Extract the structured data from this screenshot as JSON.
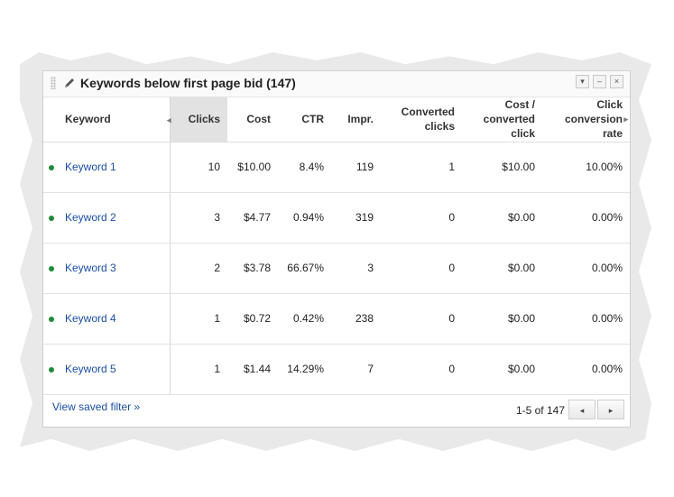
{
  "widget": {
    "title": "Keywords below first page bid (147)",
    "icons": {
      "drag": "grip-icon",
      "edit": "pencil-icon",
      "menu": "dropdown-icon",
      "minimize": "minimize-icon",
      "close": "close-icon"
    },
    "menu_glyph": "▾",
    "minimize_glyph": "–",
    "close_glyph": "×"
  },
  "table": {
    "columns": {
      "keyword": "Keyword",
      "clicks": "Clicks",
      "cost": "Cost",
      "ctr": "CTR",
      "impr": "Impr.",
      "converted_clicks": "Converted clicks",
      "cost_per_converted_click": "Cost / converted click",
      "click_conversion_rate": "Click conversion rate"
    },
    "sorted_column": "clicks",
    "scroll_left_glyph": "◂",
    "scroll_right_glyph": "▸",
    "rows": [
      {
        "keyword": "Keyword 1",
        "clicks": "10",
        "cost": "$10.00",
        "ctr": "8.4%",
        "impr": "119",
        "converted": "1",
        "cpc": "$10.00",
        "rate": "10.00%"
      },
      {
        "keyword": "Keyword 2",
        "clicks": "3",
        "cost": "$4.77",
        "ctr": "0.94%",
        "impr": "319",
        "converted": "0",
        "cpc": "$0.00",
        "rate": "0.00%"
      },
      {
        "keyword": "Keyword 3",
        "clicks": "2",
        "cost": "$3.78",
        "ctr": "66.67%",
        "impr": "3",
        "converted": "0",
        "cpc": "$0.00",
        "rate": "0.00%"
      },
      {
        "keyword": "Keyword 4",
        "clicks": "1",
        "cost": "$0.72",
        "ctr": "0.42%",
        "impr": "238",
        "converted": "0",
        "cpc": "$0.00",
        "rate": "0.00%"
      },
      {
        "keyword": "Keyword 5",
        "clicks": "1",
        "cost": "$1.44",
        "ctr": "14.29%",
        "impr": "7",
        "converted": "0",
        "cpc": "$0.00",
        "rate": "0.00%"
      }
    ],
    "status_color": "#1f8a3a"
  },
  "footer": {
    "saved_filter_link": "View saved filter »",
    "pagination": "1-5 of 147",
    "prev_glyph": "◂",
    "next_glyph": "▸"
  },
  "colors": {
    "link": "#1a4fa3",
    "sorted_header_bg": "#e2e2e2"
  }
}
